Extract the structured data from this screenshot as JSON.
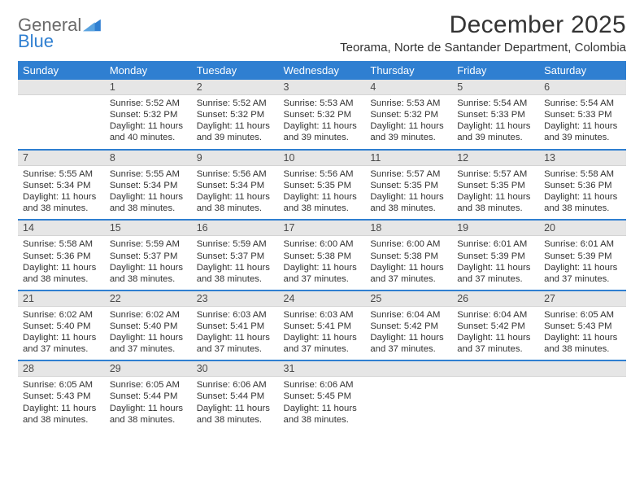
{
  "logo": {
    "line1": "General",
    "line2": "Blue"
  },
  "title": "December 2025",
  "location": "Teorama, Norte de Santander Department, Colombia",
  "day_headers": [
    "Sunday",
    "Monday",
    "Tuesday",
    "Wednesday",
    "Thursday",
    "Friday",
    "Saturday"
  ],
  "weeks": [
    [
      {
        "n": "",
        "sunrise": "",
        "sunset": "",
        "daylight": ""
      },
      {
        "n": "1",
        "sunrise": "Sunrise: 5:52 AM",
        "sunset": "Sunset: 5:32 PM",
        "daylight": "Daylight: 11 hours and 40 minutes."
      },
      {
        "n": "2",
        "sunrise": "Sunrise: 5:52 AM",
        "sunset": "Sunset: 5:32 PM",
        "daylight": "Daylight: 11 hours and 39 minutes."
      },
      {
        "n": "3",
        "sunrise": "Sunrise: 5:53 AM",
        "sunset": "Sunset: 5:32 PM",
        "daylight": "Daylight: 11 hours and 39 minutes."
      },
      {
        "n": "4",
        "sunrise": "Sunrise: 5:53 AM",
        "sunset": "Sunset: 5:32 PM",
        "daylight": "Daylight: 11 hours and 39 minutes."
      },
      {
        "n": "5",
        "sunrise": "Sunrise: 5:54 AM",
        "sunset": "Sunset: 5:33 PM",
        "daylight": "Daylight: 11 hours and 39 minutes."
      },
      {
        "n": "6",
        "sunrise": "Sunrise: 5:54 AM",
        "sunset": "Sunset: 5:33 PM",
        "daylight": "Daylight: 11 hours and 39 minutes."
      }
    ],
    [
      {
        "n": "7",
        "sunrise": "Sunrise: 5:55 AM",
        "sunset": "Sunset: 5:34 PM",
        "daylight": "Daylight: 11 hours and 38 minutes."
      },
      {
        "n": "8",
        "sunrise": "Sunrise: 5:55 AM",
        "sunset": "Sunset: 5:34 PM",
        "daylight": "Daylight: 11 hours and 38 minutes."
      },
      {
        "n": "9",
        "sunrise": "Sunrise: 5:56 AM",
        "sunset": "Sunset: 5:34 PM",
        "daylight": "Daylight: 11 hours and 38 minutes."
      },
      {
        "n": "10",
        "sunrise": "Sunrise: 5:56 AM",
        "sunset": "Sunset: 5:35 PM",
        "daylight": "Daylight: 11 hours and 38 minutes."
      },
      {
        "n": "11",
        "sunrise": "Sunrise: 5:57 AM",
        "sunset": "Sunset: 5:35 PM",
        "daylight": "Daylight: 11 hours and 38 minutes."
      },
      {
        "n": "12",
        "sunrise": "Sunrise: 5:57 AM",
        "sunset": "Sunset: 5:35 PM",
        "daylight": "Daylight: 11 hours and 38 minutes."
      },
      {
        "n": "13",
        "sunrise": "Sunrise: 5:58 AM",
        "sunset": "Sunset: 5:36 PM",
        "daylight": "Daylight: 11 hours and 38 minutes."
      }
    ],
    [
      {
        "n": "14",
        "sunrise": "Sunrise: 5:58 AM",
        "sunset": "Sunset: 5:36 PM",
        "daylight": "Daylight: 11 hours and 38 minutes."
      },
      {
        "n": "15",
        "sunrise": "Sunrise: 5:59 AM",
        "sunset": "Sunset: 5:37 PM",
        "daylight": "Daylight: 11 hours and 38 minutes."
      },
      {
        "n": "16",
        "sunrise": "Sunrise: 5:59 AM",
        "sunset": "Sunset: 5:37 PM",
        "daylight": "Daylight: 11 hours and 38 minutes."
      },
      {
        "n": "17",
        "sunrise": "Sunrise: 6:00 AM",
        "sunset": "Sunset: 5:38 PM",
        "daylight": "Daylight: 11 hours and 37 minutes."
      },
      {
        "n": "18",
        "sunrise": "Sunrise: 6:00 AM",
        "sunset": "Sunset: 5:38 PM",
        "daylight": "Daylight: 11 hours and 37 minutes."
      },
      {
        "n": "19",
        "sunrise": "Sunrise: 6:01 AM",
        "sunset": "Sunset: 5:39 PM",
        "daylight": "Daylight: 11 hours and 37 minutes."
      },
      {
        "n": "20",
        "sunrise": "Sunrise: 6:01 AM",
        "sunset": "Sunset: 5:39 PM",
        "daylight": "Daylight: 11 hours and 37 minutes."
      }
    ],
    [
      {
        "n": "21",
        "sunrise": "Sunrise: 6:02 AM",
        "sunset": "Sunset: 5:40 PM",
        "daylight": "Daylight: 11 hours and 37 minutes."
      },
      {
        "n": "22",
        "sunrise": "Sunrise: 6:02 AM",
        "sunset": "Sunset: 5:40 PM",
        "daylight": "Daylight: 11 hours and 37 minutes."
      },
      {
        "n": "23",
        "sunrise": "Sunrise: 6:03 AM",
        "sunset": "Sunset: 5:41 PM",
        "daylight": "Daylight: 11 hours and 37 minutes."
      },
      {
        "n": "24",
        "sunrise": "Sunrise: 6:03 AM",
        "sunset": "Sunset: 5:41 PM",
        "daylight": "Daylight: 11 hours and 37 minutes."
      },
      {
        "n": "25",
        "sunrise": "Sunrise: 6:04 AM",
        "sunset": "Sunset: 5:42 PM",
        "daylight": "Daylight: 11 hours and 37 minutes."
      },
      {
        "n": "26",
        "sunrise": "Sunrise: 6:04 AM",
        "sunset": "Sunset: 5:42 PM",
        "daylight": "Daylight: 11 hours and 37 minutes."
      },
      {
        "n": "27",
        "sunrise": "Sunrise: 6:05 AM",
        "sunset": "Sunset: 5:43 PM",
        "daylight": "Daylight: 11 hours and 38 minutes."
      }
    ],
    [
      {
        "n": "28",
        "sunrise": "Sunrise: 6:05 AM",
        "sunset": "Sunset: 5:43 PM",
        "daylight": "Daylight: 11 hours and 38 minutes."
      },
      {
        "n": "29",
        "sunrise": "Sunrise: 6:05 AM",
        "sunset": "Sunset: 5:44 PM",
        "daylight": "Daylight: 11 hours and 38 minutes."
      },
      {
        "n": "30",
        "sunrise": "Sunrise: 6:06 AM",
        "sunset": "Sunset: 5:44 PM",
        "daylight": "Daylight: 11 hours and 38 minutes."
      },
      {
        "n": "31",
        "sunrise": "Sunrise: 6:06 AM",
        "sunset": "Sunset: 5:45 PM",
        "daylight": "Daylight: 11 hours and 38 minutes."
      },
      {
        "n": "",
        "sunrise": "",
        "sunset": "",
        "daylight": ""
      },
      {
        "n": "",
        "sunrise": "",
        "sunset": "",
        "daylight": ""
      },
      {
        "n": "",
        "sunrise": "",
        "sunset": "",
        "daylight": ""
      }
    ]
  ]
}
